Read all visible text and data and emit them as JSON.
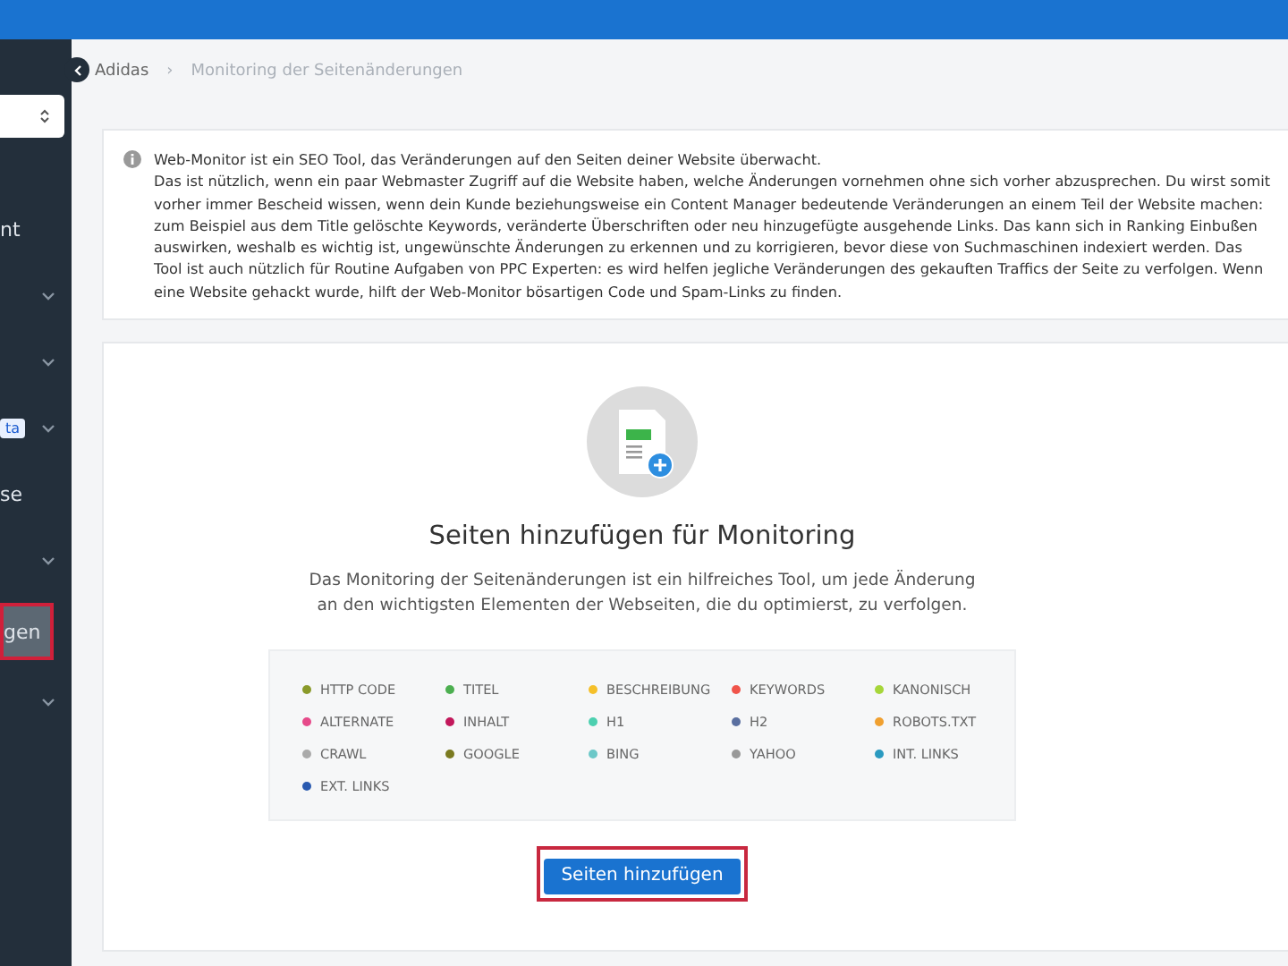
{
  "sidebar": {
    "select": {
      "expandable": true
    },
    "items": [
      {
        "label": "nt",
        "expandable": false,
        "selected": false
      },
      {
        "expandable": true,
        "selected": false
      },
      {
        "expandable": true,
        "selected": false
      },
      {
        "badge": "ta",
        "expandable": true,
        "selected": false
      },
      {
        "label": "se",
        "expandable": false,
        "selected": false
      },
      {
        "expandable": true,
        "selected": false
      },
      {
        "label": "gen",
        "expandable": false,
        "selected": true
      },
      {
        "expandable": true,
        "selected": false
      }
    ]
  },
  "breadcrumb": {
    "items": [
      "Adidas",
      "Monitoring der Seitenänderungen"
    ],
    "separator": "›"
  },
  "info": {
    "lines": [
      "Web-Monitor ist ein SEO Tool, das Veränderungen auf den Seiten deiner Website überwacht.",
      "Das ist nützlich, wenn ein paar Webmaster Zugriff auf die Website haben, welche Änderungen vornehmen ohne sich vorher abzusprechen. Du wirst somit vorher immer Bescheid wissen, wenn dein Kunde beziehungsweise ein Content Manager bedeutende Veränderungen an einem Teil der Website machen: zum Beispiel aus dem Title gelöschte Keywords, veränderte Überschriften oder neu hinzugefügte ausgehende Links. Das kann sich in Ranking Einbußen auswirken, weshalb es wichtig ist, ungewünschte Änderungen zu erkennen und zu korrigieren, bevor diese von Suchmaschinen indexiert werden. Das Tool ist auch nützlich für Routine Aufgaben von PPC Experten: es wird helfen jegliche Veränderungen des gekauften Traffics der Seite zu verfolgen. Wenn eine Website gehackt wurde, hilft der Web-Monitor bösartigen Code und Spam-Links zu finden."
    ]
  },
  "empty_state": {
    "title": "Seiten hinzufügen für Monitoring",
    "description": "Das Monitoring der Seitenänderungen ist ein hilfreiches Tool, um jede Änderung an den wichtigsten Elementen der Webseiten, die du optimierst, zu verfolgen.",
    "legend": [
      {
        "label": "HTTP CODE",
        "color": "#8a9a2a"
      },
      {
        "label": "TITEL",
        "color": "#4caf50"
      },
      {
        "label": "BESCHREIBUNG",
        "color": "#f5c02a"
      },
      {
        "label": "KEYWORDS",
        "color": "#f0544a"
      },
      {
        "label": "KANONISCH",
        "color": "#a6d63a"
      },
      {
        "label": "ALTERNATE",
        "color": "#e64a8a"
      },
      {
        "label": "INHALT",
        "color": "#c2185b"
      },
      {
        "label": "H1",
        "color": "#4dd0b0"
      },
      {
        "label": "H2",
        "color": "#5a6fa0"
      },
      {
        "label": "ROBOTS.TXT",
        "color": "#f0a030"
      },
      {
        "label": "CRAWL",
        "color": "#aaaaaa"
      },
      {
        "label": "GOOGLE",
        "color": "#7a7a20"
      },
      {
        "label": "BING",
        "color": "#6cc8c8"
      },
      {
        "label": "YAHOO",
        "color": "#999999"
      },
      {
        "label": "INT. LINKS",
        "color": "#2a9ac0"
      },
      {
        "label": "EXT. LINKS",
        "color": "#2a5ab0"
      }
    ],
    "button": {
      "label": "Seiten hinzufügen",
      "highlighted": true
    }
  }
}
